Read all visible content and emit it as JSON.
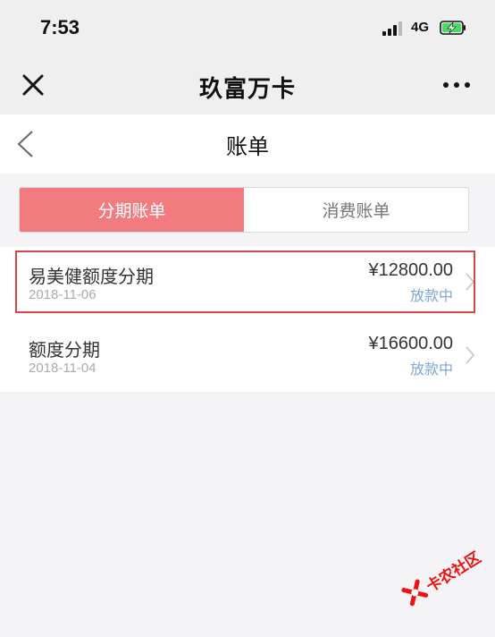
{
  "status_bar": {
    "time": "7:53",
    "network": "4G",
    "icons": [
      "signal-icon",
      "battery-charging-icon"
    ]
  },
  "wechat_nav": {
    "title": "玖富万卡",
    "icons": [
      "close-icon",
      "more-icon"
    ]
  },
  "page_header": {
    "title": "账单",
    "icons": [
      "back-icon"
    ]
  },
  "tabs": [
    {
      "label": "分期账单",
      "active": true
    },
    {
      "label": "消费账单",
      "active": false
    }
  ],
  "bills": [
    {
      "name": "易美健额度分期",
      "date": "2018-11-06",
      "amount": "¥12800.00",
      "status": "放款中",
      "highlighted": true
    },
    {
      "name": "额度分期",
      "date": "2018-11-04",
      "amount": "¥16600.00",
      "status": "放款中",
      "highlighted": false
    }
  ],
  "watermark": {
    "text": "卡农社区"
  },
  "colors": {
    "accent": "#f27b80",
    "status": "#7fa6d9",
    "highlight_border": "#d84548",
    "watermark": "#ee1111"
  }
}
